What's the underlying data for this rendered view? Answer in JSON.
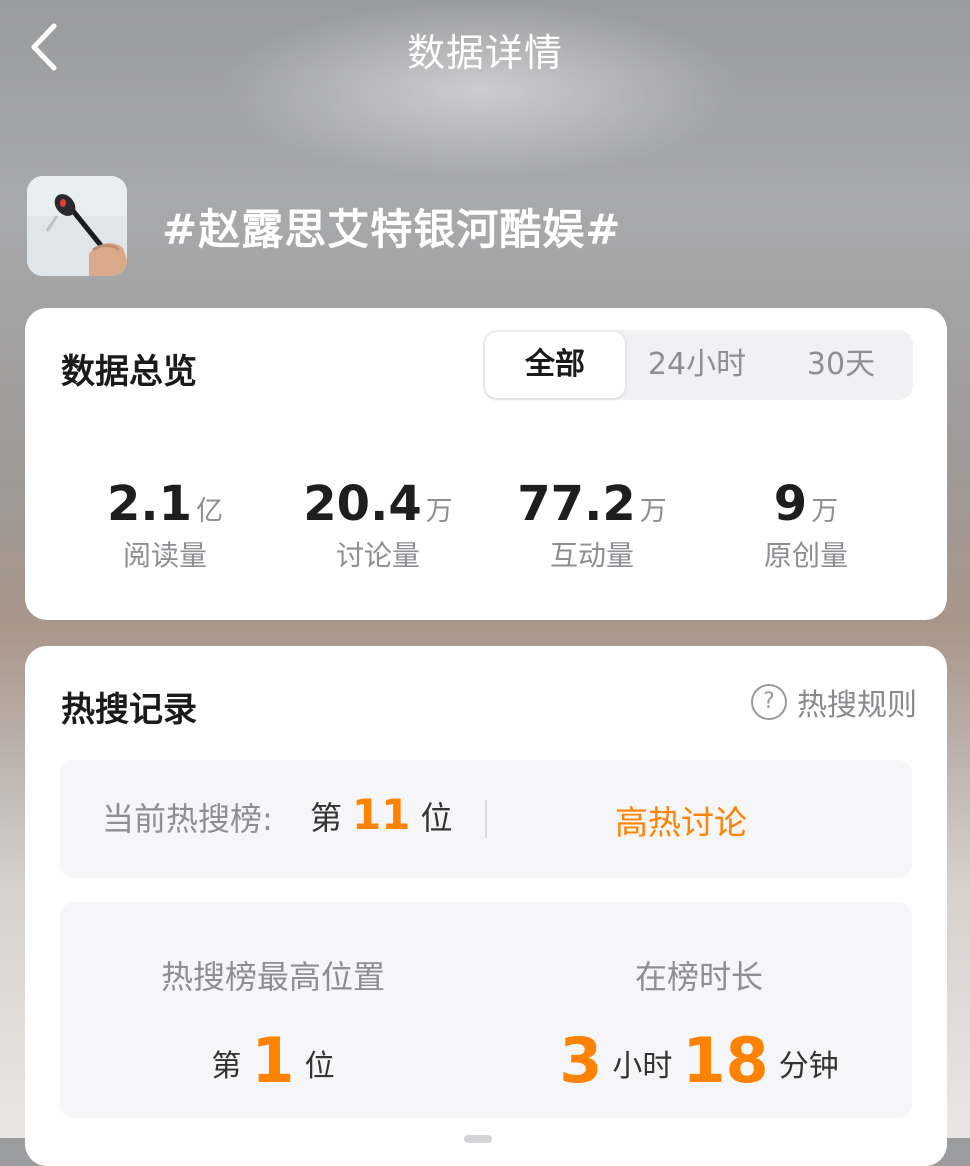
{
  "header": {
    "title": "数据详情"
  },
  "topic": {
    "title": "#赵露思艾特银河酷娱#"
  },
  "overview": {
    "heading": "数据总览",
    "tabs": [
      {
        "label": "全部",
        "active": true
      },
      {
        "label": "24小时",
        "active": false
      },
      {
        "label": "30天",
        "active": false
      }
    ],
    "stats": [
      {
        "value": "2.1",
        "unit": "亿",
        "label": "阅读量"
      },
      {
        "value": "20.4",
        "unit": "万",
        "label": "讨论量"
      },
      {
        "value": "77.2",
        "unit": "万",
        "label": "互动量"
      },
      {
        "value": "9",
        "unit": "万",
        "label": "原创量"
      }
    ]
  },
  "hot": {
    "heading": "热搜记录",
    "rules_label": "热搜规则",
    "current": {
      "label": "当前热搜榜:",
      "prefix": "第",
      "rank": "11",
      "suffix": "位",
      "badge": "高热讨论"
    },
    "best": {
      "title": "热搜榜最高位置",
      "prefix": "第",
      "rank": "1",
      "suffix": "位"
    },
    "duration": {
      "title": "在榜时长",
      "hours": "3",
      "hours_unit": "小时",
      "minutes": "18",
      "minutes_unit": "分钟"
    }
  },
  "colors": {
    "accent": "#ff8200",
    "card": "#ffffff",
    "muted": "#8e8e93"
  },
  "icons": {
    "back": "chevron-left-icon",
    "help": "question-circle-icon"
  }
}
